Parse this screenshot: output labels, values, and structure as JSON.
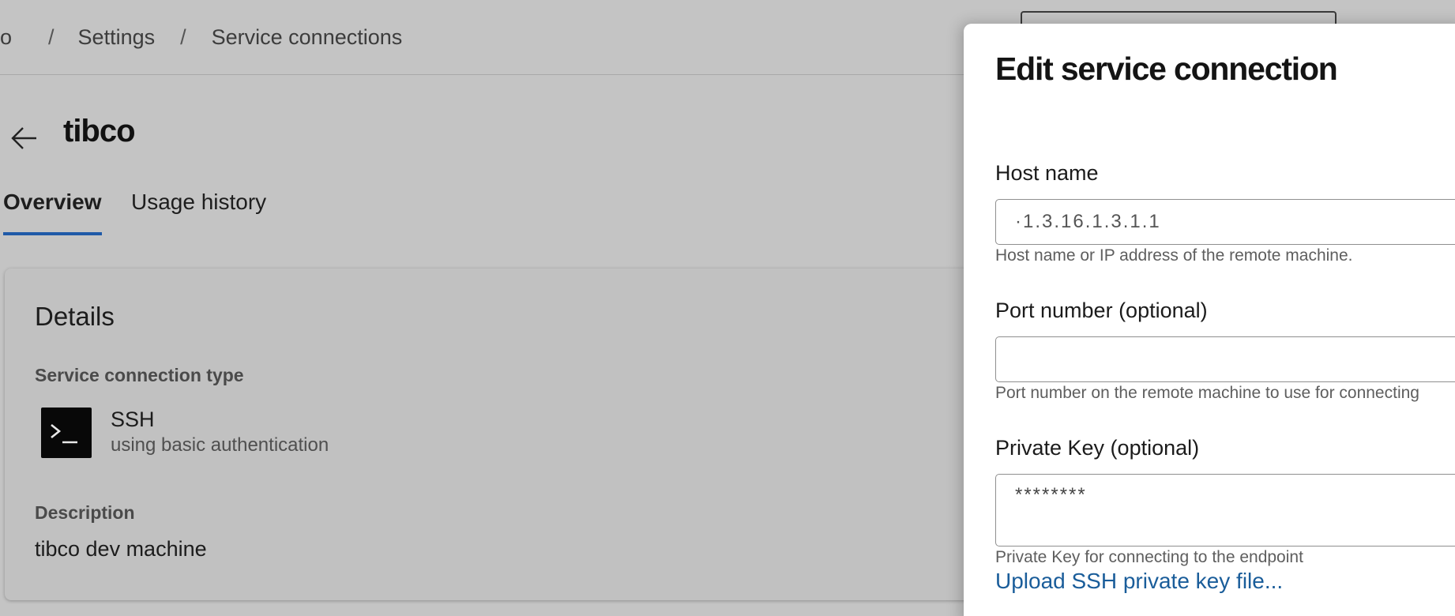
{
  "breadcrumb": {
    "partial_item": "o",
    "items": [
      "Settings",
      "Service connections"
    ],
    "separator": "/"
  },
  "page": {
    "title": "tibco"
  },
  "tabs": [
    {
      "label": "Overview",
      "active": true
    },
    {
      "label": "Usage history",
      "active": false
    }
  ],
  "details": {
    "title": "Details",
    "type_label": "Service connection type",
    "type_name": "SSH",
    "type_auth": "using basic authentication",
    "type_icon": "terminal-icon",
    "description_label": "Description",
    "description_value": "tibco dev machine"
  },
  "panel": {
    "title": "Edit service connection",
    "host": {
      "label": "Host name",
      "value": "·1.3.16.1.3.1.1",
      "helper": "Host name or IP address of the remote machine."
    },
    "port": {
      "label": "Port number (optional)",
      "value": "",
      "helper": "Port number on the remote machine to use for connecting"
    },
    "private_key": {
      "label": "Private Key (optional)",
      "value": "********",
      "helper": "Private Key for connecting to the endpoint"
    },
    "upload_link": "Upload SSH private key file..."
  },
  "colors": {
    "accent": "#1f5aa8",
    "link": "#1a5d9a",
    "overlay_bg": "#c4c4c4",
    "panel_bg": "#ffffff"
  }
}
